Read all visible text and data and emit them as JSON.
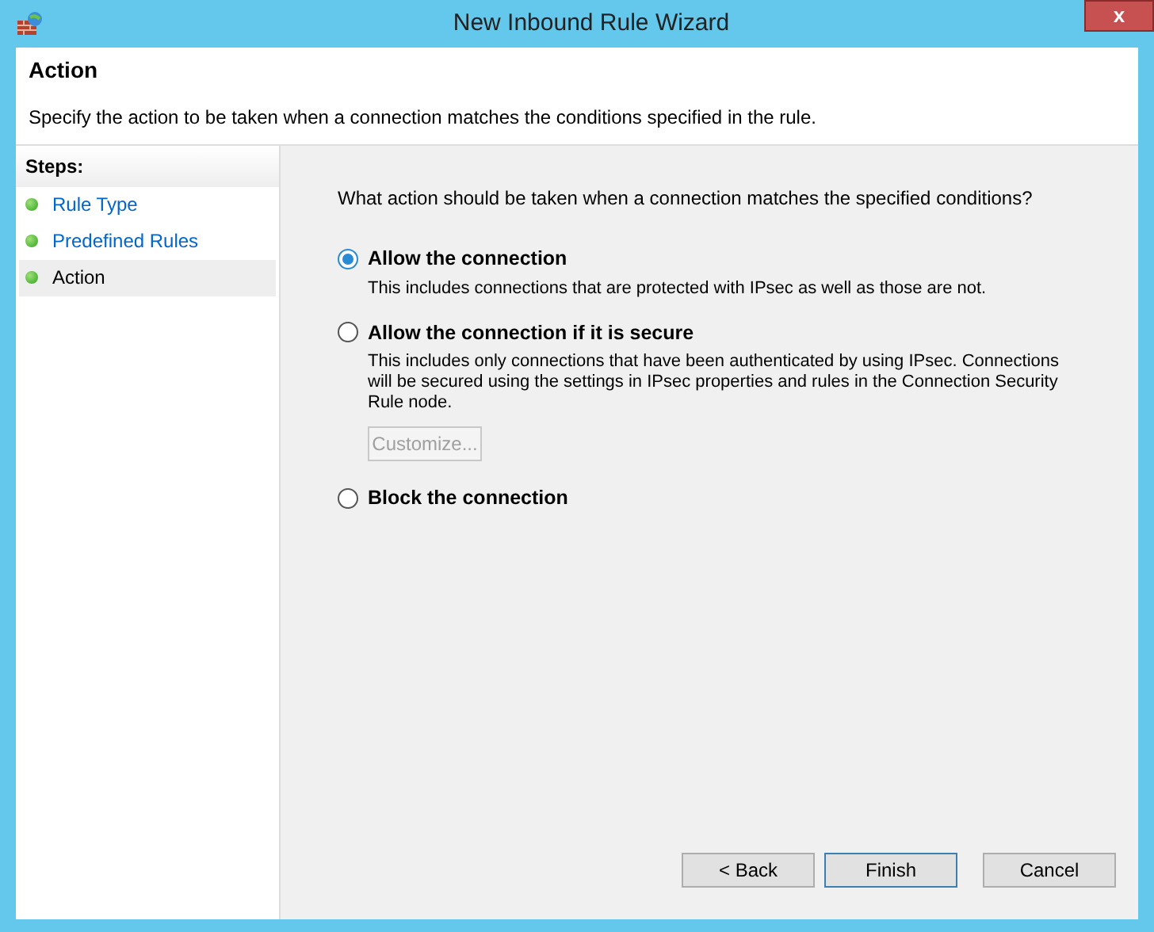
{
  "window": {
    "title": "New Inbound Rule Wizard",
    "close": "x"
  },
  "header": {
    "title": "Action",
    "description": "Specify the action to be taken when a connection matches the conditions specified in the rule."
  },
  "steps": {
    "heading": "Steps:",
    "items": [
      {
        "label": "Rule Type",
        "selected": false
      },
      {
        "label": "Predefined Rules",
        "selected": false
      },
      {
        "label": "Action",
        "selected": true
      }
    ]
  },
  "question": "What action should be taken when a connection matches the specified conditions?",
  "options": [
    {
      "label": "Allow the connection",
      "selected": true,
      "description": "This includes connections that are protected with IPsec as well as those are not."
    },
    {
      "label": "Allow the connection if it is secure",
      "selected": false,
      "description": "This includes only connections that have been authenticated by using IPsec.  Connections will be secured using the settings in IPsec properties and rules in the Connection Security Rule node.",
      "button": {
        "label": "Customize...",
        "disabled": true
      }
    },
    {
      "label": "Block the connection",
      "selected": false
    }
  ],
  "buttons": [
    {
      "label": "< Back",
      "default": false
    },
    {
      "label": "Finish",
      "default": true
    },
    {
      "label": "Cancel",
      "default": false
    }
  ]
}
